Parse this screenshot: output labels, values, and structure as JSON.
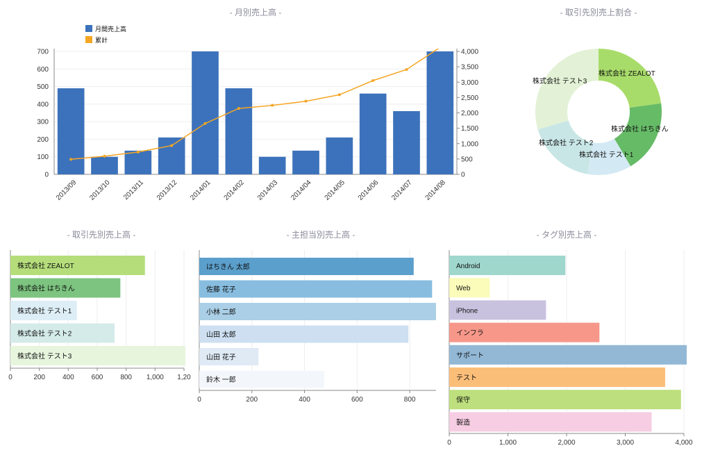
{
  "chart_data": [
    {
      "id": "monthly",
      "type": "bar",
      "title": "- 月別売上高 -",
      "categories": [
        "2013/09",
        "2013/10",
        "2013/11",
        "2013/12",
        "2014/01",
        "2014/02",
        "2014/03",
        "2014/04",
        "2014/05",
        "2014/06",
        "2014/07",
        "2014/08"
      ],
      "series": [
        {
          "name": "月間売上高",
          "type": "bar",
          "axis": "left",
          "color": "#3c72bb",
          "values": [
            490,
            100,
            135,
            210,
            720,
            490,
            100,
            135,
            210,
            460,
            360,
            720
          ]
        },
        {
          "name": "累計",
          "type": "line",
          "axis": "right",
          "color": "#f5a623",
          "values": [
            490,
            590,
            725,
            935,
            1655,
            2145,
            2245,
            2380,
            2590,
            3050,
            3410,
            4130
          ]
        }
      ],
      "ylim": [
        0,
        700
      ],
      "yticks": [
        0,
        100,
        200,
        300,
        400,
        500,
        600,
        700
      ],
      "y2lim": [
        0,
        4000
      ],
      "y2ticks": [
        0,
        500,
        1000,
        1500,
        2000,
        2500,
        3000,
        3500,
        4000
      ],
      "y2ticklabels": [
        "0",
        "500",
        "1,000",
        "1,500",
        "2,000",
        "2,500",
        "3,000",
        "3,500",
        "4,000"
      ],
      "legend": "top-left",
      "grid": true
    },
    {
      "id": "client_share",
      "type": "pie",
      "title": "- 取引先別売上割合 -",
      "labels": [
        "株式会社 ZEALOT",
        "株式会社 はちきん",
        "株式会社 テスト1",
        "株式会社 テスト2",
        "株式会社 テスト3"
      ],
      "values": [
        930,
        760,
        460,
        720,
        1200
      ],
      "colors": [
        "#a8dc6a",
        "#66bb66",
        "#d3e9f3",
        "#c9e6e6",
        "#e3f2d6"
      ],
      "donut": true
    },
    {
      "id": "client_bar",
      "type": "bar",
      "orientation": "horizontal",
      "title": "- 取引先別売上高 -",
      "categories": [
        "株式会社 ZEALOT",
        "株式会社 はちきん",
        "株式会社 テスト1",
        "株式会社 テスト2",
        "株式会社 テスト3"
      ],
      "values": [
        930,
        760,
        460,
        720,
        1210
      ],
      "colors": [
        "#b5de7b",
        "#7cc47f",
        "#deeef6",
        "#d4ebea",
        "#e7f5dd"
      ],
      "xlim": [
        0,
        1200
      ],
      "xticks": [
        0,
        200,
        400,
        600,
        800,
        1000,
        1200
      ],
      "xticklabels": [
        "0",
        "200",
        "400",
        "600",
        "800",
        "1,000",
        "1,20"
      ],
      "grid": true
    },
    {
      "id": "staff_bar",
      "type": "bar",
      "orientation": "horizontal",
      "title": "- 主担当別売上高 -",
      "categories": [
        "はちきん 太郎",
        "佐藤 花子",
        "小林 二郎",
        "山田 太郎",
        "山田 花子",
        "鈴木 一郎"
      ],
      "values": [
        815,
        885,
        900,
        795,
        225,
        475
      ],
      "colors": [
        "#5b9fcc",
        "#88bde0",
        "#aacfe6",
        "#cddff0",
        "#dfeaf5",
        "#f3f7fc"
      ],
      "xlim": [
        0,
        900
      ],
      "xticks": [
        0,
        200,
        400,
        600,
        800
      ],
      "xticklabels": [
        "0",
        "200",
        "400",
        "600",
        "800"
      ],
      "grid": true
    },
    {
      "id": "tag_bar",
      "type": "bar",
      "orientation": "horizontal",
      "title": "- タグ別売上高 -",
      "categories": [
        "Android",
        "Web",
        "iPhone",
        "インフラ",
        "サポート",
        "テスト",
        "保守",
        "製造"
      ],
      "values": [
        1980,
        690,
        1650,
        2560,
        4080,
        3680,
        3950,
        3450
      ],
      "colors": [
        "#9fd7cd",
        "#fbfbba",
        "#c9c2df",
        "#f7978a",
        "#92b8d6",
        "#fbbe79",
        "#bddf7d",
        "#f6cde2"
      ],
      "xlim": [
        0,
        4000
      ],
      "xticks": [
        0,
        1000,
        2000,
        3000,
        4000
      ],
      "xticklabels": [
        "0",
        "1,000",
        "2,000",
        "3,000",
        "4,000"
      ],
      "grid": true
    }
  ]
}
